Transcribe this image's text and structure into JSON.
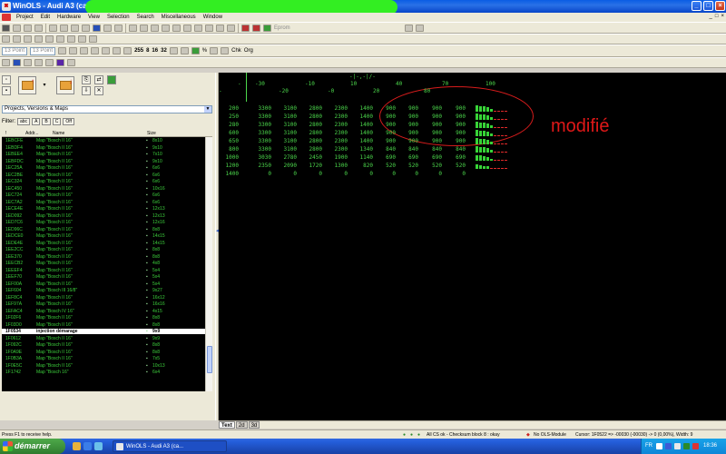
{
  "window": {
    "title": "WinOLS - Audi A3 (carto",
    "min": "_",
    "max": "□",
    "close": "×",
    "mdi_min": "_",
    "mdi_max": "□",
    "mdi_close": "×"
  },
  "menu": [
    "Project",
    "Edit",
    "Hardware",
    "View",
    "Selection",
    "Search",
    "Miscellaneous",
    "Window"
  ],
  "toolbar": {
    "eprom_label": "Eprom",
    "font_size_1": "13 Point",
    "font_size_2": "13 Point",
    "hex_buttons": [
      "255",
      "8",
      "16",
      "32"
    ],
    "percent": "%",
    "toggle_labels": [
      "Chk",
      "Org"
    ]
  },
  "left_panel": {
    "dropdown_value": "Projects, Versions & Maps",
    "filter_label": "Filter:",
    "filter_buttons": [
      "abc",
      "A",
      "B",
      "C",
      "Off"
    ],
    "columns": [
      "!",
      "Addr...",
      "Name",
      "Size"
    ],
    "rows": [
      {
        "addr": "1EBCFE",
        "name": "Map \"Bosch II 16\"",
        "size": "8x10"
      },
      {
        "addr": "1EBDF4",
        "name": "Map \"Bosch II 16\"",
        "size": "9x10"
      },
      {
        "addr": "1EBEE4",
        "name": "Map \"Bosch II 16\"",
        "size": "7x10"
      },
      {
        "addr": "1EBFDC",
        "name": "Map \"Bosch II 16\"",
        "size": "9x10"
      },
      {
        "addr": "1EC25A",
        "name": "Map \"Bosch II 16\"",
        "size": "6x6"
      },
      {
        "addr": "1EC2BE",
        "name": "Map \"Bosch II 16\"",
        "size": "6x6"
      },
      {
        "addr": "1EC324",
        "name": "Map \"Bosch II 16\"",
        "size": "6x6"
      },
      {
        "addr": "1EC450",
        "name": "Map \"Bosch II 16\"",
        "size": "10x16"
      },
      {
        "addr": "1EC724",
        "name": "Map \"Bosch II 16\"",
        "size": "6x6"
      },
      {
        "addr": "1EC7A2",
        "name": "Map \"Bosch II 16\"",
        "size": "6x6"
      },
      {
        "addr": "1ECE4E",
        "name": "Map \"Bosch II 16\"",
        "size": "12x13"
      },
      {
        "addr": "1ED092",
        "name": "Map \"Bosch II 16\"",
        "size": "12x13"
      },
      {
        "addr": "1ED7C6",
        "name": "Map \"Bosch II 16\"",
        "size": "12x16"
      },
      {
        "addr": "1ED96C",
        "name": "Map \"Bosch II 16\"",
        "size": "8x8"
      },
      {
        "addr": "1EDCE0",
        "name": "Map \"Bosch II 16\"",
        "size": "14x15"
      },
      {
        "addr": "1EDE4E",
        "name": "Map \"Bosch II 16\"",
        "size": "14x15"
      },
      {
        "addr": "1EE2CC",
        "name": "Map \"Bosch II 16\"",
        "size": "8x8"
      },
      {
        "addr": "1EE370",
        "name": "Map \"Bosch II 16\"",
        "size": "8x8"
      },
      {
        "addr": "1EECB2",
        "name": "Map \"Bosch II 16\"",
        "size": "4x8"
      },
      {
        "addr": "1EEEF4",
        "name": "Map \"Bosch II 16\"",
        "size": "5x4"
      },
      {
        "addr": "1EEF70",
        "name": "Map \"Bosch II 16\"",
        "size": "5x4"
      },
      {
        "addr": "1EF00A",
        "name": "Map \"Bosch II 16\"",
        "size": "5x4"
      },
      {
        "addr": "1EF604",
        "name": "Map \"Bosch III 16/8\"",
        "size": "9x27"
      },
      {
        "addr": "1EF8C4",
        "name": "Map \"Bosch II 16\"",
        "size": "16x12"
      },
      {
        "addr": "1EF97A",
        "name": "Map \"Bosch II 16\"",
        "size": "16x16"
      },
      {
        "addr": "1EFAC4",
        "name": "Map \"Bosch IV 16\"",
        "size": "4x15"
      },
      {
        "addr": "1F02F6",
        "name": "Map \"Bosch II 16\"",
        "size": "8x8"
      },
      {
        "addr": "1F03D0",
        "name": "Map \"Bosch II 16\"",
        "size": "8x8"
      },
      {
        "addr": "1F0534",
        "name": "injection démarage",
        "size": "9x9",
        "highlight": true
      },
      {
        "addr": "1F0612",
        "name": "Map \"Bosch II 16\"",
        "size": "9x9"
      },
      {
        "addr": "1F092C",
        "name": "Map \"Bosch II 16\"",
        "size": "8x8"
      },
      {
        "addr": "1F0A9E",
        "name": "Map \"Bosch II 16\"",
        "size": "8x8"
      },
      {
        "addr": "1F0B3A",
        "name": "Map \"Bosch II 16\"",
        "size": "7x5"
      },
      {
        "addr": "1F0E5C",
        "name": "Map \"Bosch II 16\"",
        "size": "10x13"
      },
      {
        "addr": "1F1742",
        "name": "Map \"Bosch 16\"",
        "size": "6x4"
      }
    ]
  },
  "hex": {
    "axis_label": "-|-,-|/-",
    "header_top": [
      "-30",
      "-10",
      "10",
      "40",
      "70",
      "100"
    ],
    "header_bottom": [
      "-20",
      "-0",
      "20",
      "80"
    ],
    "row_headers": [
      "200",
      "250",
      "280",
      "600",
      "650",
      "800",
      "1000",
      "1200",
      "1400"
    ],
    "rows": [
      [
        "3300",
        "3100",
        "2800",
        "2300",
        "1400",
        "900",
        "900",
        "900",
        "900"
      ],
      [
        "3300",
        "3100",
        "2800",
        "2300",
        "1400",
        "900",
        "900",
        "900",
        "900"
      ],
      [
        "3300",
        "3100",
        "2800",
        "2300",
        "1400",
        "900",
        "900",
        "900",
        "900"
      ],
      [
        "3300",
        "3100",
        "2800",
        "2300",
        "1400",
        "900",
        "900",
        "900",
        "900"
      ],
      [
        "3300",
        "3100",
        "2800",
        "2300",
        "1400",
        "900",
        "900",
        "900",
        "900"
      ],
      [
        "3300",
        "3100",
        "2800",
        "2300",
        "1340",
        "840",
        "840",
        "840",
        "840"
      ],
      [
        "3030",
        "2780",
        "2450",
        "1900",
        "1140",
        "690",
        "690",
        "690",
        "690"
      ],
      [
        "2350",
        "2090",
        "1720",
        "1300",
        "820",
        "520",
        "520",
        "520",
        "520"
      ],
      [
        "0",
        "0",
        "0",
        "0",
        "0",
        "0",
        "0",
        "0",
        "0"
      ]
    ],
    "bar_levels": [
      [
        1.0,
        0.9,
        0.8,
        0.7,
        0.5,
        0.3,
        0.3,
        0.3,
        0.3
      ],
      [
        1.0,
        0.9,
        0.8,
        0.7,
        0.5,
        0.3,
        0.3,
        0.3,
        0.3
      ],
      [
        1.0,
        0.9,
        0.8,
        0.7,
        0.5,
        0.3,
        0.3,
        0.3,
        0.3
      ],
      [
        1.0,
        0.9,
        0.8,
        0.7,
        0.5,
        0.3,
        0.3,
        0.3,
        0.3
      ],
      [
        1.0,
        0.9,
        0.8,
        0.7,
        0.5,
        0.3,
        0.3,
        0.3,
        0.3
      ],
      [
        1.0,
        0.9,
        0.8,
        0.7,
        0.4,
        0.25,
        0.25,
        0.25,
        0.25
      ],
      [
        0.9,
        0.8,
        0.7,
        0.6,
        0.35,
        0.2,
        0.2,
        0.2,
        0.2
      ],
      [
        0.7,
        0.6,
        0.5,
        0.4,
        0.25,
        0.15,
        0.15,
        0.15,
        0.15
      ],
      [
        0,
        0,
        0,
        0,
        0,
        0,
        0,
        0,
        0
      ]
    ],
    "annotation": "modifié"
  },
  "view_tabs": [
    "Text",
    "2d",
    "3d"
  ],
  "status": {
    "help": "Press F1 to receive help.",
    "checksum": "All CS ok - Checksum block 8 : okay",
    "module": "No OLS-Module",
    "cursor": "Cursor: 1F0522 => -00030 (-00030) -> 0 (0,00%), Width: 9"
  },
  "taskbar": {
    "start": "démarrer",
    "task_item": "WinOLS - Audi A3 (ca...",
    "language": "FR",
    "clock": "18:36"
  },
  "colors": {
    "hex_green": "#4cd84c",
    "list_green": "#3ccf3c",
    "annotation_red": "#e01818",
    "title_blue": "#0a5de4"
  }
}
